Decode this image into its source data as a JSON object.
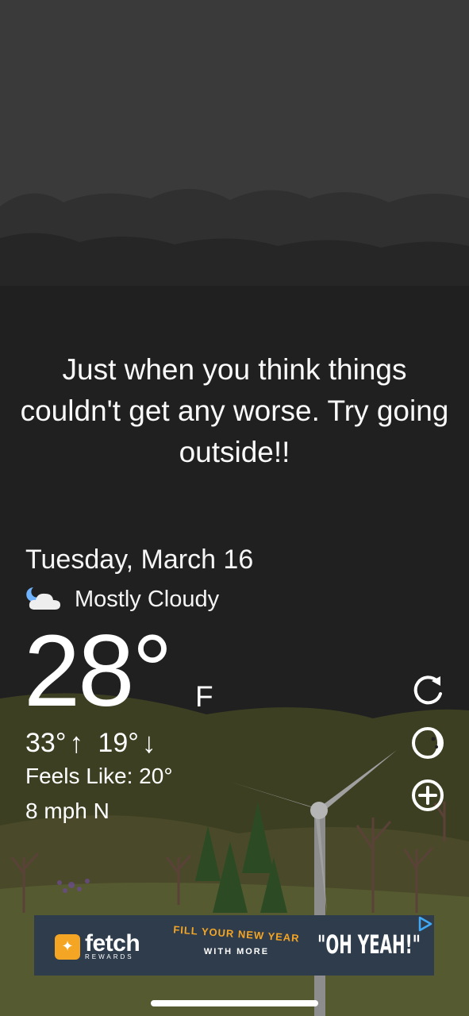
{
  "quote": "Just when you think things couldn't get any worse. Try going outside!!",
  "weather": {
    "date": "Tuesday, March 16",
    "condition": "Mostly Cloudy",
    "condition_icon": "partly-cloudy-night-icon",
    "temperature": "28°",
    "unit": "F",
    "high": "33°",
    "low": "19°",
    "feels_like": "Feels Like: 20°",
    "wind": "8 mph N"
  },
  "actions": {
    "refresh_icon": "refresh-icon",
    "theme_icon": "moon-icon",
    "add_icon": "add-circle-icon"
  },
  "ad": {
    "brand": "fetch",
    "brand_sub": "REWARDS",
    "headline": "FILL YOUR NEW YEAR",
    "subline": "WITH MORE",
    "tagline": "\"OH YEAH!\"",
    "choices_icon": "adchoices-icon",
    "accent_color": "#f5a524",
    "background_color": "#2e3c4c"
  }
}
